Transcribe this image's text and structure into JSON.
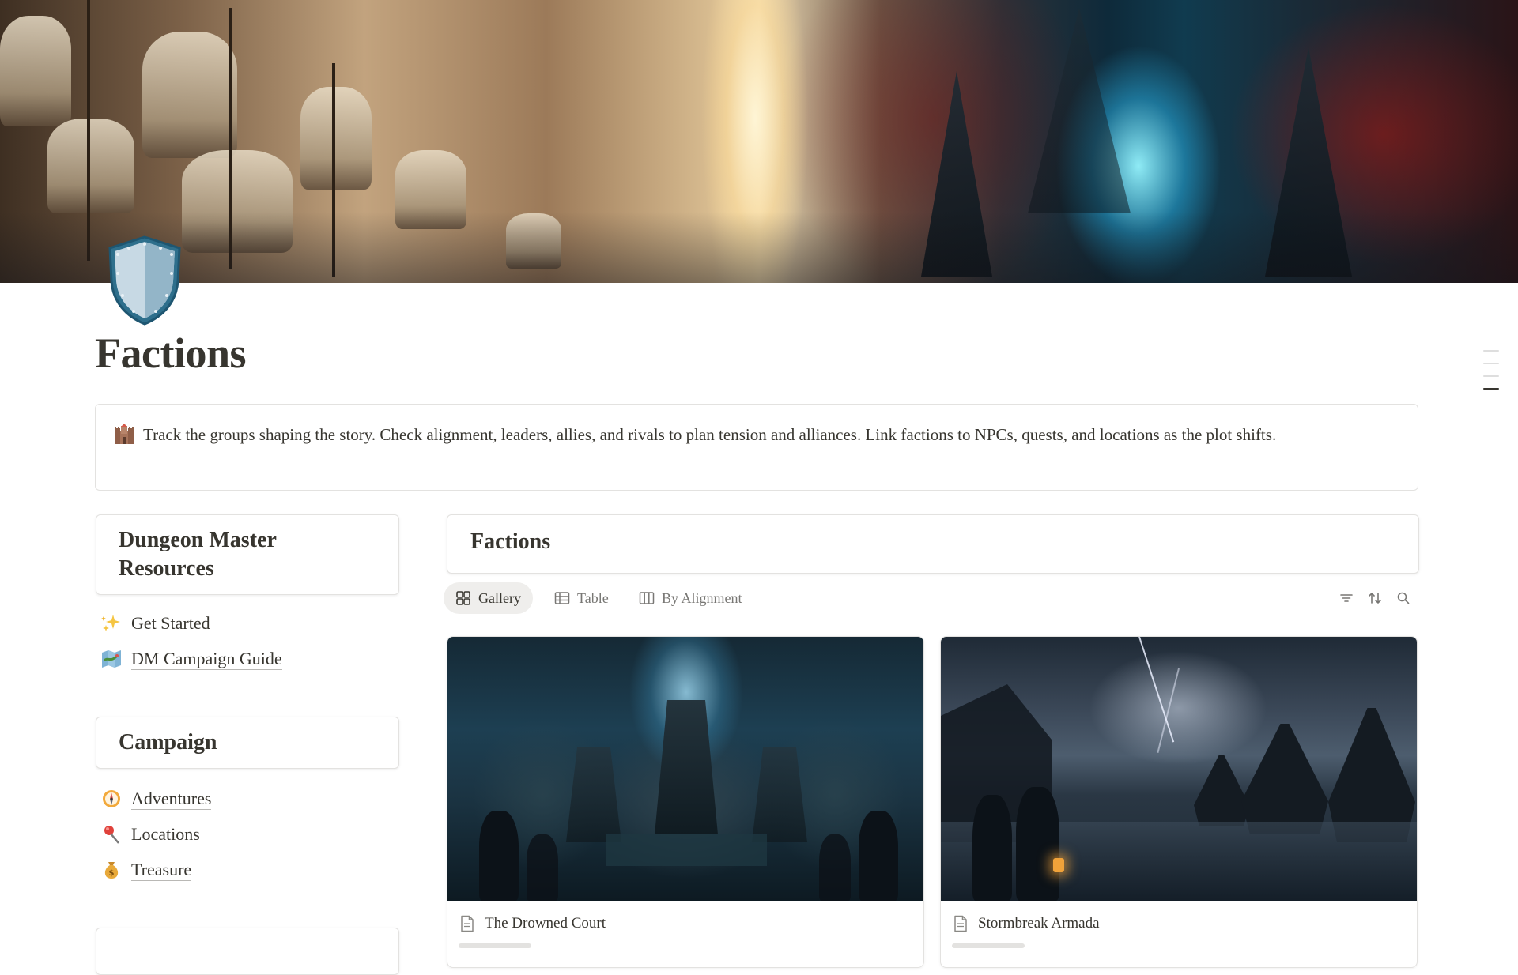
{
  "page": {
    "title": "Factions",
    "icon": "shield-icon"
  },
  "callout": {
    "icon": "castle-icon",
    "text": "Track the groups shaping the story. Check alignment, leaders, allies, and rivals to plan tension and alliances. Link factions to NPCs, quests, and locations as the plot shifts."
  },
  "sidebar": {
    "resources": {
      "title": "Dungeon Master Resources",
      "links": [
        {
          "label": "Get Started",
          "icon": "sparkles-icon"
        },
        {
          "label": "DM Campaign Guide",
          "icon": "map-icon"
        }
      ]
    },
    "campaign": {
      "title": "Campaign",
      "links": [
        {
          "label": "Adventures",
          "icon": "compass-icon"
        },
        {
          "label": "Locations",
          "icon": "pin-icon"
        },
        {
          "label": "Treasure",
          "icon": "money-bag-icon"
        }
      ]
    }
  },
  "database": {
    "title": "Factions",
    "views": [
      {
        "label": "Gallery",
        "icon": "gallery-icon",
        "active": true
      },
      {
        "label": "Table",
        "icon": "table-icon",
        "active": false
      },
      {
        "label": "By Alignment",
        "icon": "board-icon",
        "active": false
      }
    ],
    "tools": [
      "filter-icon",
      "sort-icon",
      "search-icon"
    ],
    "cards": [
      {
        "name": "The Drowned Court"
      },
      {
        "name": "Stormbreak Armada"
      }
    ]
  },
  "colors": {
    "text": "#37352f",
    "muted": "#787774",
    "border": "#e3e2e0",
    "active_tab_bg": "#efeeec"
  }
}
